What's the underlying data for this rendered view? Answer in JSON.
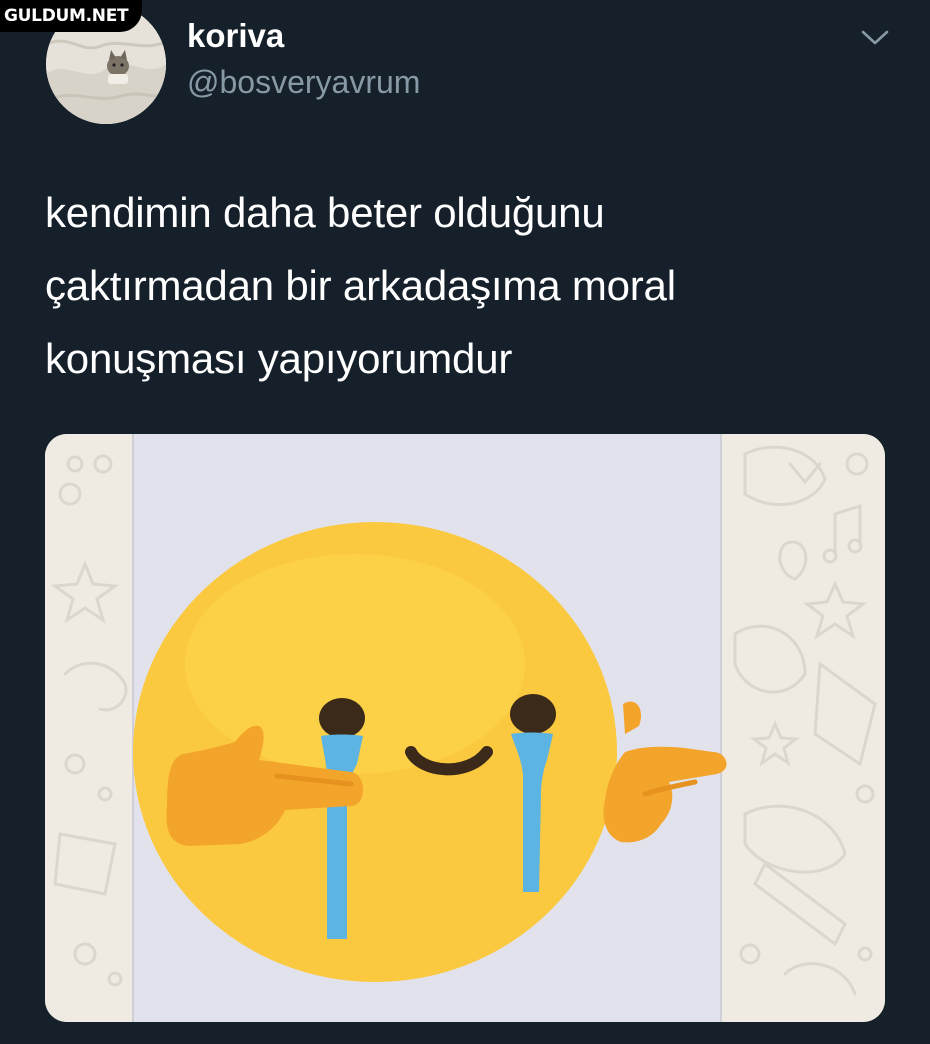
{
  "watermark": {
    "text": "GULDUM.NET"
  },
  "tweet": {
    "display_name": "koriva",
    "handle": "@bosveryavrum",
    "text": "kendimin daha beter olduğunu\nçaktırmadan bir arkadaşıma moral\nkonuşması yapıyorumdur"
  },
  "icons": {
    "menu": "chevron-down-icon",
    "media": "crying-pointing-emoji"
  },
  "colors": {
    "background": "#15202b",
    "text": "#ffffff",
    "secondary_text": "#8899a6",
    "emoji_face": "#fbc93f",
    "emoji_hands": "#f3a52b",
    "tears": "#5cb4e3"
  }
}
